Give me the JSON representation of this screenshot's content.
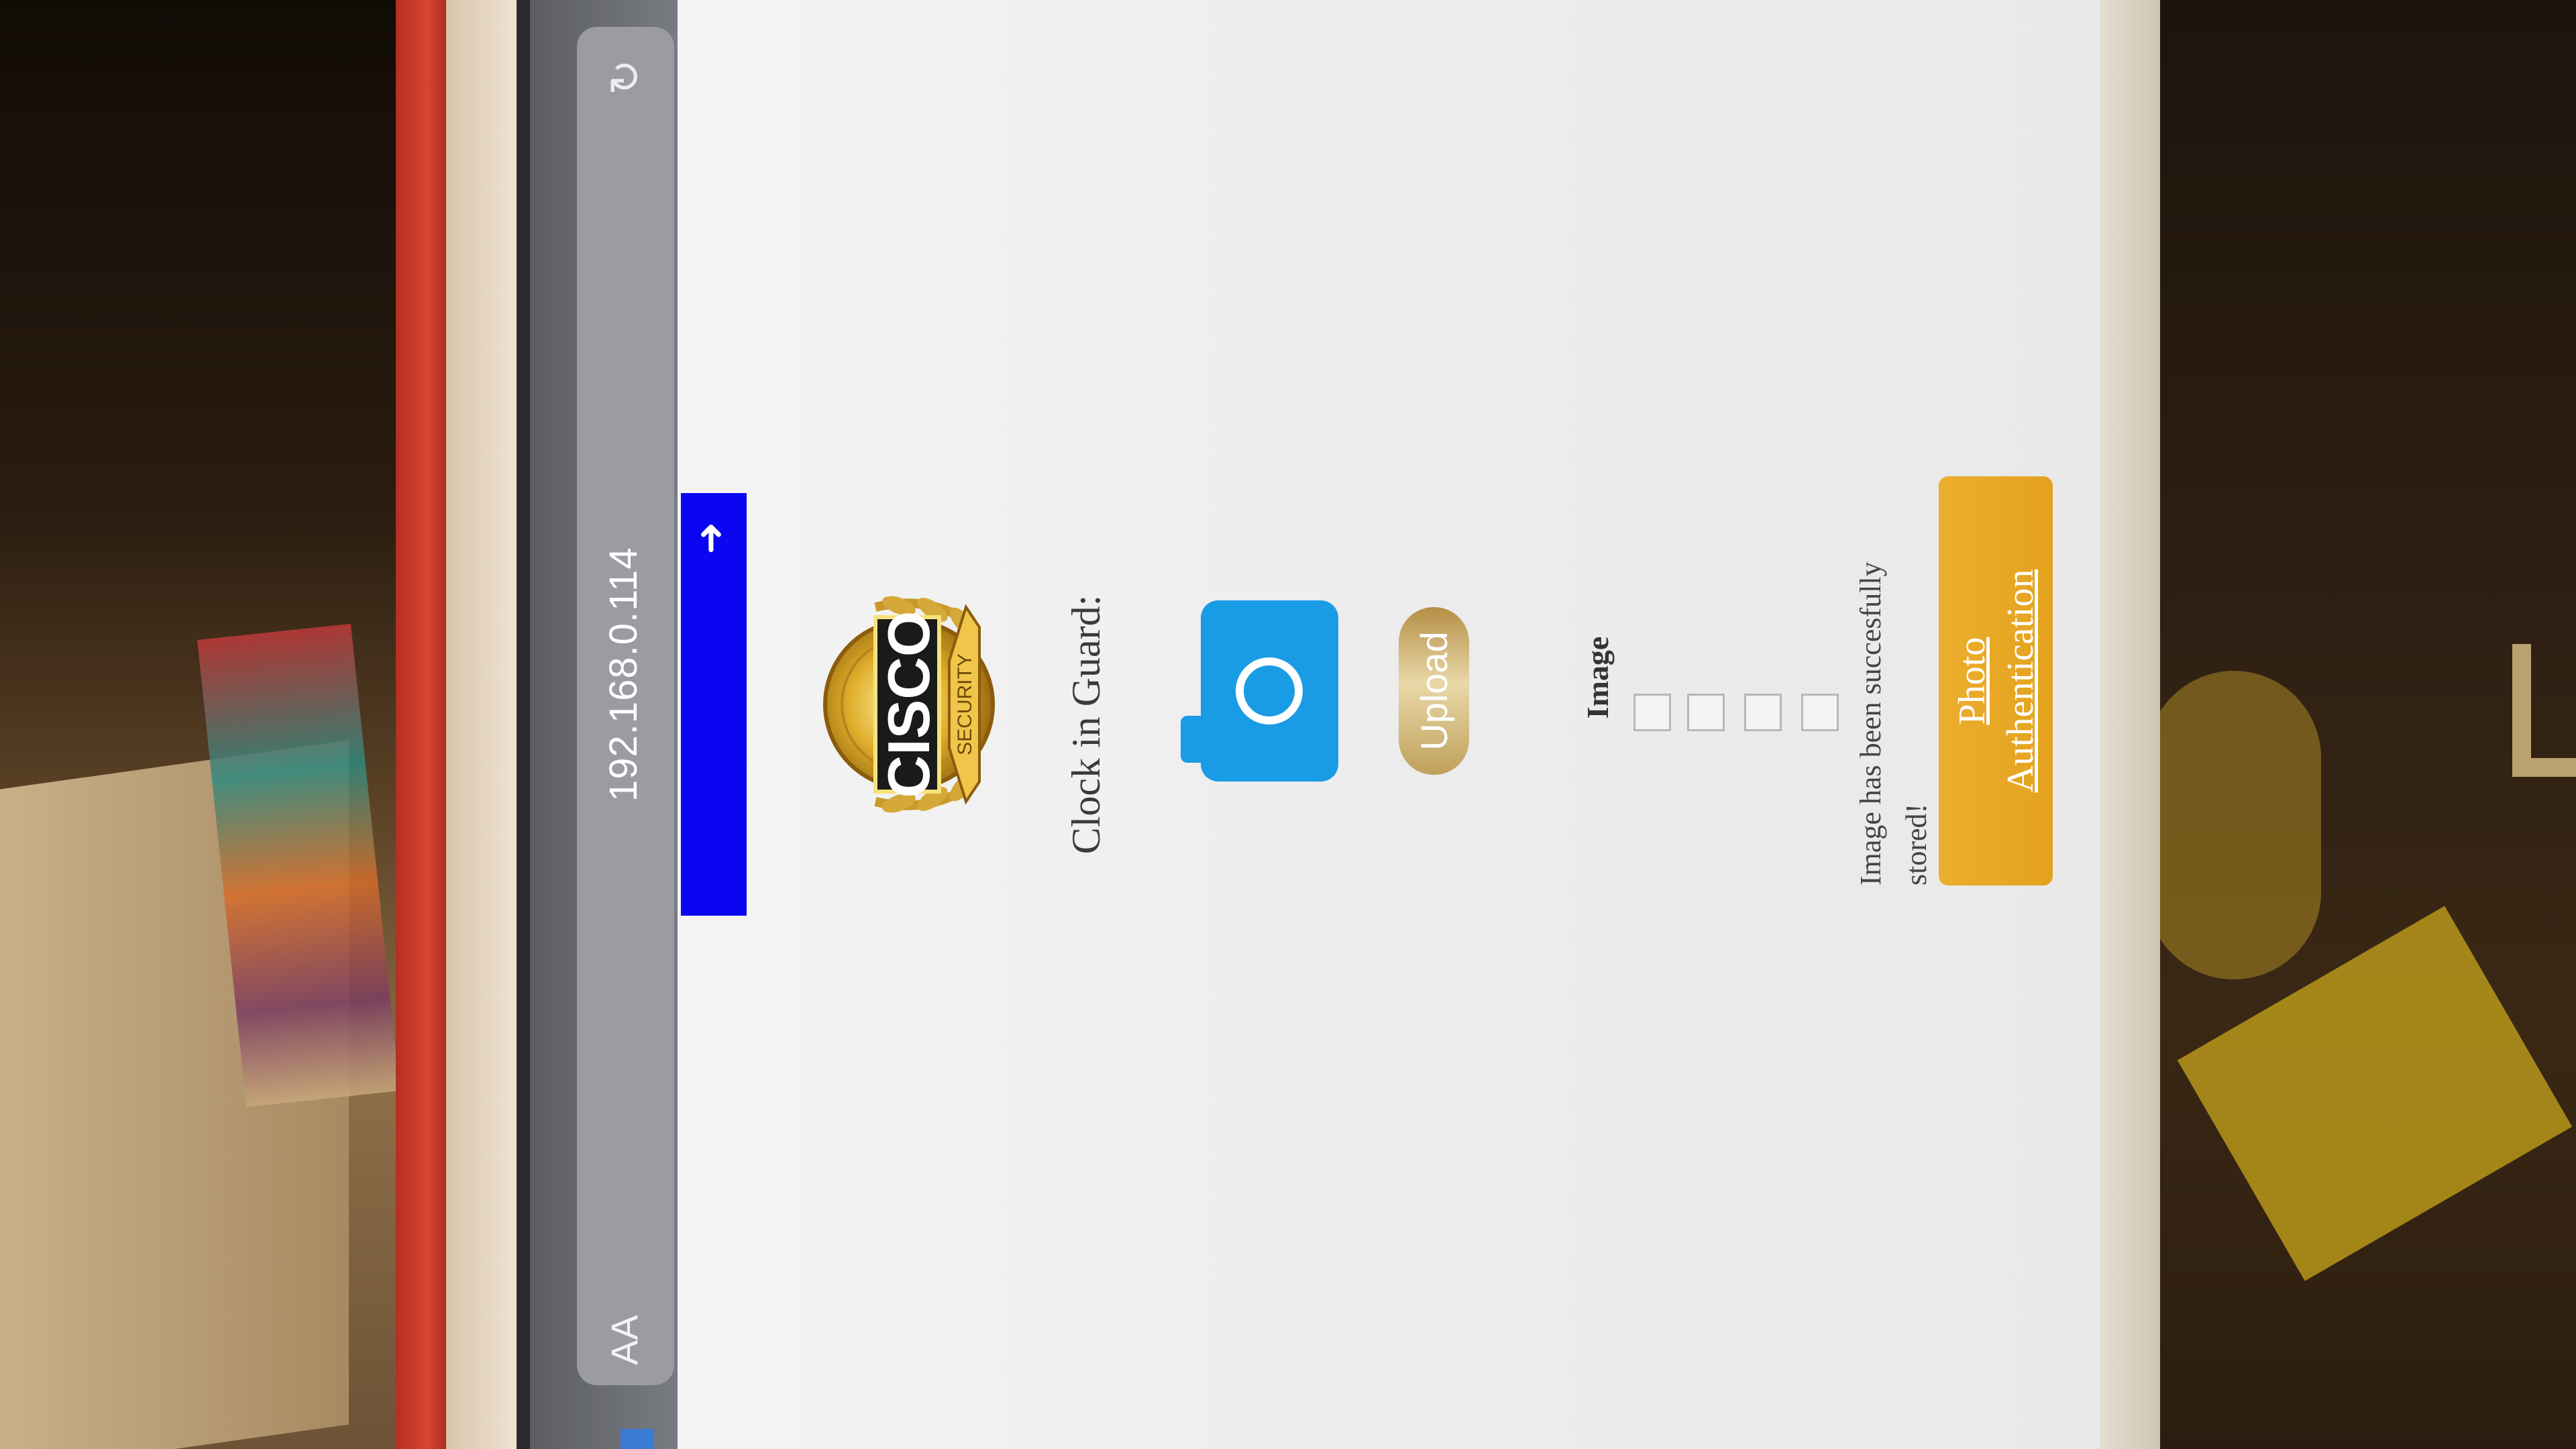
{
  "browser": {
    "reader_label": "AA",
    "url": "192.168.0.114",
    "reload_icon": "reload-icon"
  },
  "page": {
    "back_icon": "back-arrow-icon",
    "logo": {
      "brand": "CISCO",
      "tagline": "SECURITY"
    },
    "clock_label": "Clock in Guard:",
    "camera_icon": "camera-icon",
    "upload_label": "Upload",
    "image_section": {
      "label": "Image",
      "checkbox_count": 4
    },
    "status_message": "Image has been succesfully stored!",
    "auth_button": {
      "line1": "Photo",
      "line2": "Authentication"
    }
  },
  "colors": {
    "banner": "#0a06f2",
    "camera": "#1a9be6",
    "upload": "#d4bb7e",
    "auth": "#e8a826"
  }
}
